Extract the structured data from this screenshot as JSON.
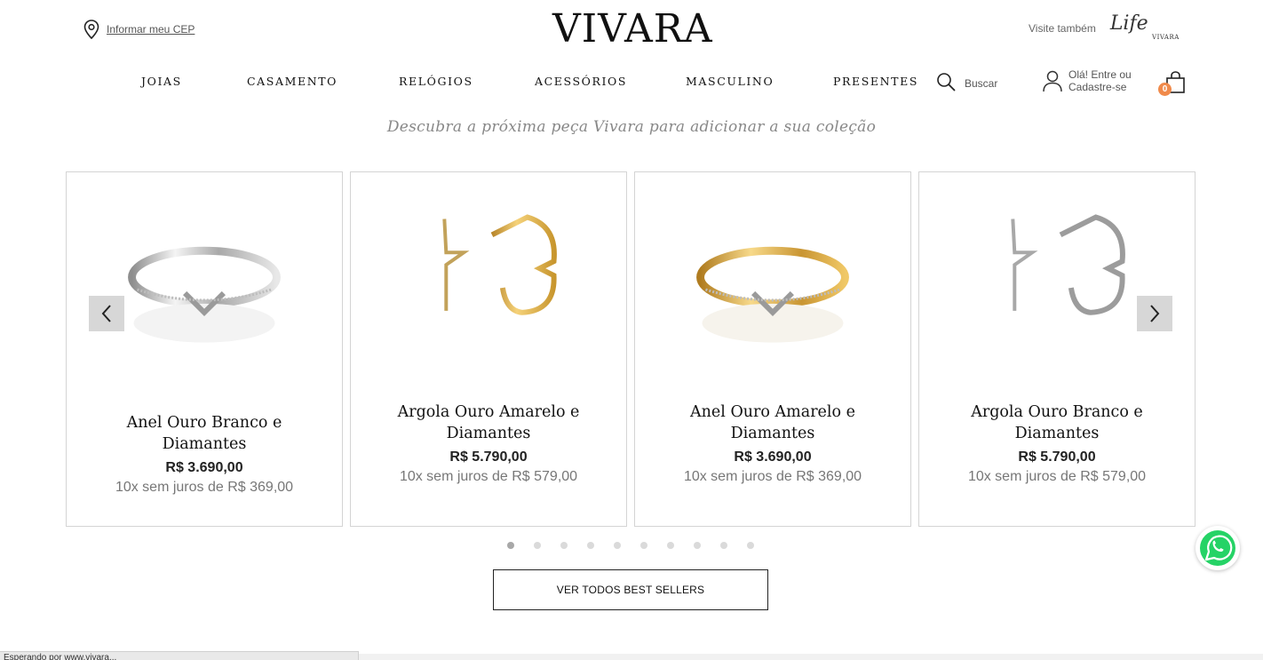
{
  "header": {
    "cep_label": "Informar meu CEP",
    "logo_text": "VIVARA",
    "visit_label": "Visite também",
    "life_logo": {
      "script": "Life",
      "sub": "VIVARA"
    }
  },
  "nav": {
    "items": [
      "JOIAS",
      "CASAMENTO",
      "RELÓGIOS",
      "ACESSÓRIOS",
      "MASCULINO",
      "PRESENTES"
    ],
    "search_label": "Buscar",
    "account_label": "Olá! Entre ou Cadastre-se",
    "cart_count": "0"
  },
  "section": {
    "subtitle": "Descubra a próxima peça Vivara para adicionar a sua coleção",
    "see_all_label": "VER TODOS BEST SELLERS"
  },
  "products": [
    {
      "name": "Anel Ouro Branco e Diamantes",
      "price": "R$ 3.690,00",
      "installments": "10x sem juros de R$ 369,00",
      "metal": "white",
      "kind": "ring"
    },
    {
      "name": "Argola Ouro Amarelo e Diamantes",
      "price": "R$ 5.790,00",
      "installments": "10x sem juros de R$ 579,00",
      "metal": "yellow",
      "kind": "hoop"
    },
    {
      "name": "Anel Ouro Amarelo e Diamantes",
      "price": "R$ 3.690,00",
      "installments": "10x sem juros de R$ 369,00",
      "metal": "yellow",
      "kind": "ring"
    },
    {
      "name": "Argola Ouro Branco e Diamantes",
      "price": "R$ 5.790,00",
      "installments": "10x sem juros de R$ 579,00",
      "metal": "white",
      "kind": "hoop"
    }
  ],
  "carousel": {
    "dot_count": 10,
    "active_dot": 0
  },
  "colors": {
    "badge": "#f08a4b",
    "whatsapp": "#25d366",
    "white_metal": "#cfcfcf",
    "yellow_metal": "#d9a93a"
  },
  "icons": [
    "location-pin-icon",
    "search-icon",
    "user-icon",
    "shopping-bag-icon",
    "chevron-left-icon",
    "chevron-right-icon",
    "whatsapp-icon"
  ],
  "statusbar": {
    "text": "Esperando por www.vivara..."
  }
}
